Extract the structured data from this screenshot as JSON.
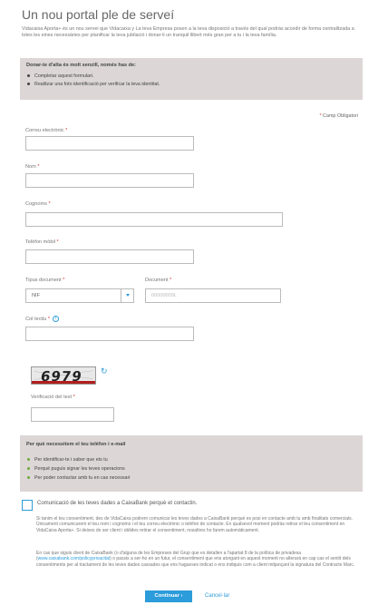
{
  "page": {
    "title": "Un nou portal ple de serveí",
    "intro": "Vidacaixa Aporta+ és un nou servei que Vidacaixa y La teva Empresa posen a la teva disposició a través del qual podràs accedir de forma centralitzada a totes les eines necessàries per planificar la teva jubilació i donar-li un tranquil llibert més gran per a tu i la teva família."
  },
  "info_top": {
    "heading": "Donar-te d'alta és molt senzill, només has de:",
    "items": [
      "Completar aquest formulari.",
      "Realitzar una foto identificació per verificar la teva identitat."
    ]
  },
  "required_note": "Camp Obligatori",
  "form": {
    "email_label": "Correu electrònic",
    "name_label": "Nom",
    "surname_label": "Cognoms",
    "phone_label": "Telèfon mòbil",
    "doc_type_label": "Tipus document",
    "doc_type_value": "NIF",
    "document_label": "Document",
    "document_placeholder": "00000000L",
    "key_label": "Col·lectiu",
    "key_info_icon": "i",
    "captcha_text": "6979",
    "verify_label": "Verificació del text"
  },
  "info_mid": {
    "heading": "Per què necessitem el teu telèfon i e-mail",
    "items": [
      "Per identificar-te i saber que ets tu",
      "Perquè puguis signar les teves operacions",
      "Per poder contactar amb tu en cas necessari"
    ]
  },
  "consent": {
    "title": "Comunicació de les teves dades a CaixaBank perquè et contactin.",
    "para1": "Si tanim el teu consentiment, des de VidaCaixa podrem comunicar les teves dades a CaixaBank perquè es posi en contacte amb tu amb finalitats comercials. Únicament comunicarem el teu nom i cognoms i el teu correu electrònic o telèfon de contacte. En qualsevol moment podràs retirar el teu consentiment en VidaCaixa Aporta+. Si deixes de ser client i oblides retirar el consentiment, nosaltres ho farem automàticament.",
    "para2_a": "En cas que siguis client de CaixaBank (o d'alguna de les Empreses del Grup que es detallen a l'apartat 8 de la política de privadesa (",
    "para2_link": "www.caixabank.com/policyprivacitat",
    "para2_b": ") o passis a ser-ho en un futur, el consentiment que ens atorgant en aquest moment no alterarà en cap cas el sentit dels consentiments per al tractament de les teves dades cassades que ens hagueses indicat o ens indiquis com a client mitjançant la signatura del Contracte Marc."
  },
  "buttons": {
    "continue": "Continuar ›",
    "cancel": "Cancel·lar"
  },
  "colors": {
    "accent": "#2c9cdb",
    "info_bg": "#dcd6d6",
    "required": "#d43c3c",
    "bullet_green": "#6dac3a"
  }
}
